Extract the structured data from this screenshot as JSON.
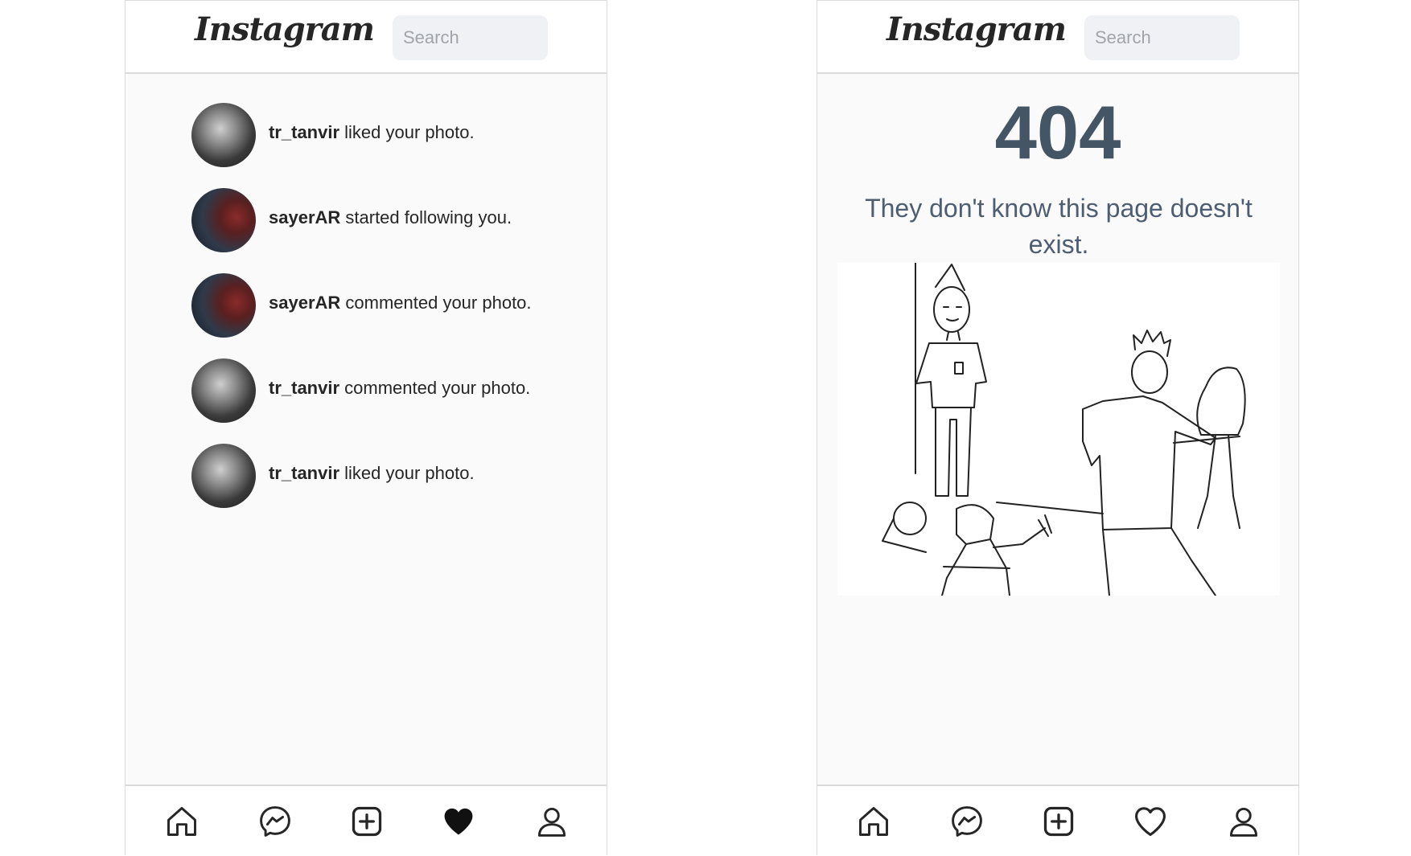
{
  "left_screen": {
    "header": {
      "logo": "Instagram",
      "search_placeholder": "Search"
    },
    "notifications": [
      {
        "user": "tr_tanvir",
        "text": " liked your photo.",
        "avatar": "gray"
      },
      {
        "user": "sayerAR",
        "text": " started following you.",
        "avatar": "color"
      },
      {
        "user": "sayerAR",
        "text": " commented your photo.",
        "avatar": "color"
      },
      {
        "user": "tr_tanvir",
        "text": " commented your photo.",
        "avatar": "gray"
      },
      {
        "user": "tr_tanvir",
        "text": " liked your photo.",
        "avatar": "gray"
      }
    ],
    "nav": [
      "home-icon",
      "messenger-icon",
      "add-post-icon",
      "heart-filled-icon",
      "profile-icon"
    ]
  },
  "right_screen": {
    "header": {
      "logo": "Instagram",
      "search_placeholder": "Search"
    },
    "error": {
      "code": "404",
      "message": "They don't know this page doesn't exist."
    },
    "nav": [
      "home-icon",
      "messenger-icon",
      "add-post-icon",
      "heart-outline-icon",
      "profile-icon"
    ]
  },
  "colors": {
    "page_bg": "#fafafa",
    "bar_bg": "#ffffff",
    "border": "#dbdbdb",
    "text": "#262626",
    "error_code": "#445566",
    "error_message": "#4d5e72",
    "search_bg": "#eff1f4"
  }
}
